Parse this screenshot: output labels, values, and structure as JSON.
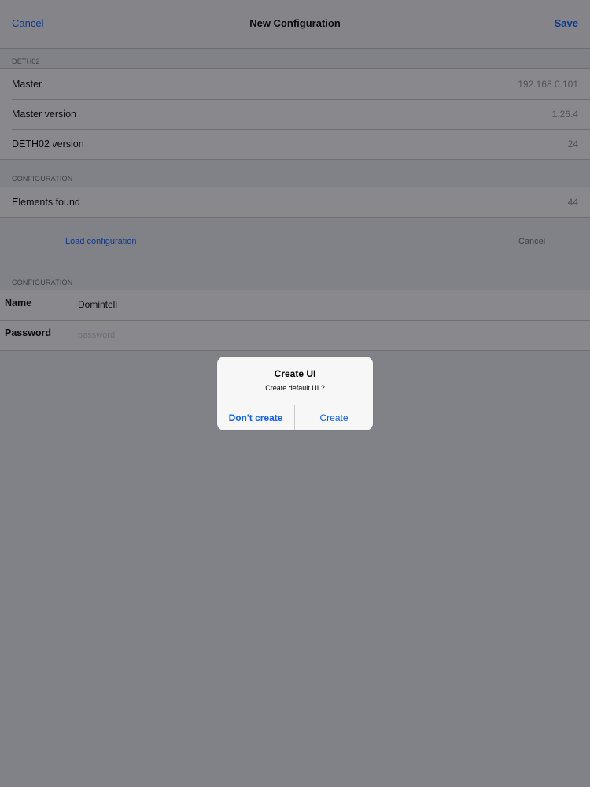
{
  "navbar": {
    "cancel_label": "Cancel",
    "title": "New Configuration",
    "save_label": "Save"
  },
  "deth02_section": {
    "header": "DETH02",
    "rows": [
      {
        "label": "Master",
        "value": "192.168.0.101"
      },
      {
        "label": "Master version",
        "value": "1.26.4"
      },
      {
        "label": "DETH02 version",
        "value": "24"
      }
    ]
  },
  "config_section": {
    "header": "CONFIGURATION",
    "rows": [
      {
        "label": "Elements found",
        "value": "44"
      }
    ]
  },
  "actions": {
    "load_label": "Load configuration",
    "cancel_label": "Cancel"
  },
  "form_section": {
    "header": "CONFIGURATION",
    "name_label": "Name",
    "name_value": "Domintell",
    "password_label": "Password",
    "password_placeholder": "password"
  },
  "alert": {
    "title": "Create UI",
    "message": "Create default UI ?",
    "dont_create_label": "Don't create",
    "create_label": "Create"
  },
  "colors": {
    "accent": "#0a60ff",
    "background": "#efeff4",
    "overlay": "rgba(20,20,28,0.5)"
  }
}
